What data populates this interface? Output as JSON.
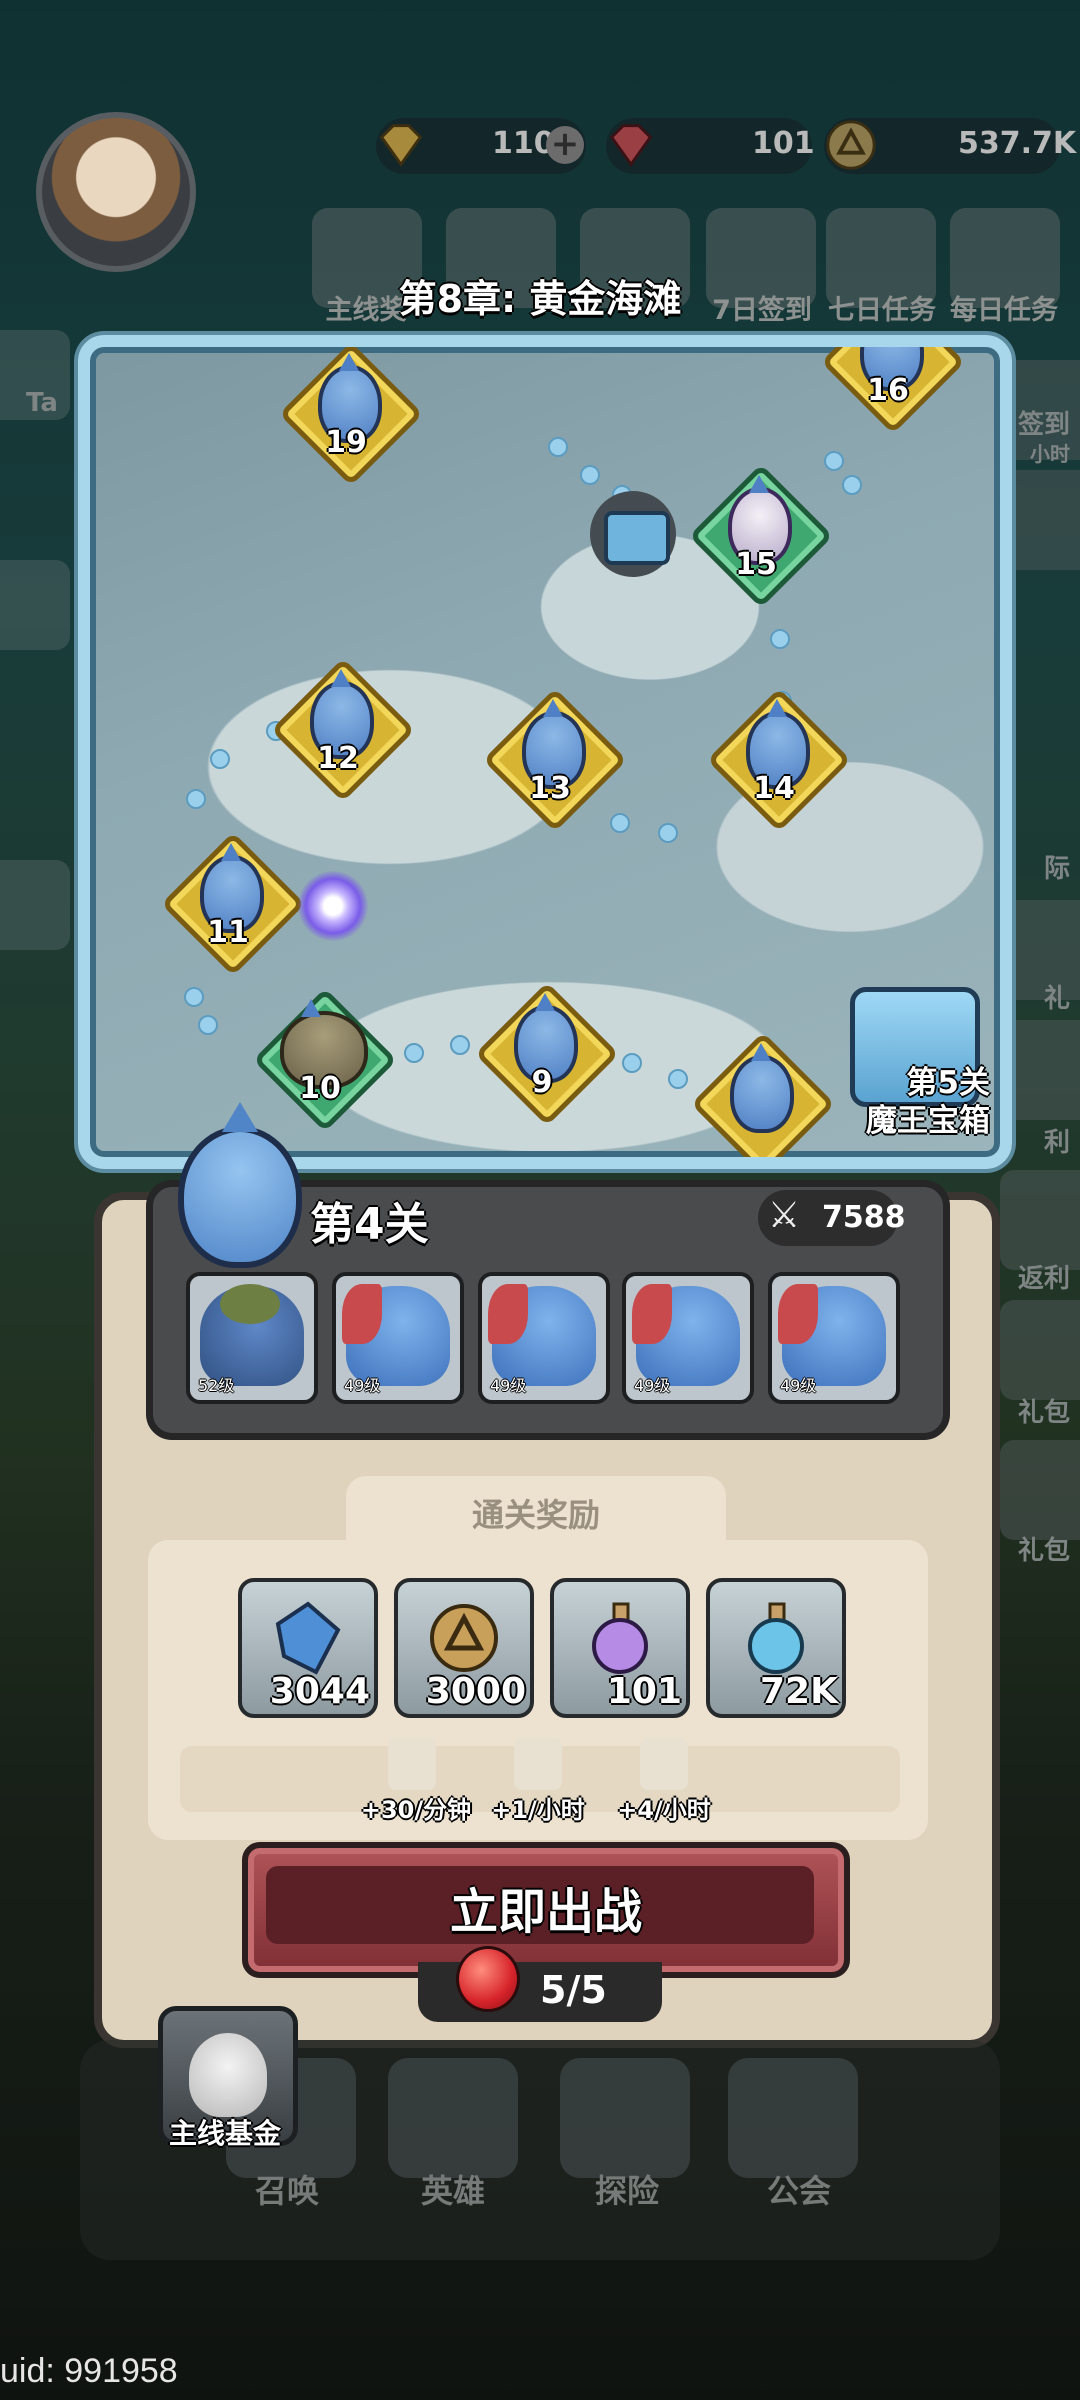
{
  "resources": {
    "gold_gem": "110",
    "red_gem": "101",
    "coins": "537.7K"
  },
  "top_icons": [
    "主线奖",
    "",
    "",
    "7日签到",
    "七日任务",
    "每日任务"
  ],
  "side_left": [
    "Ta"
  ],
  "side_right": [
    "签到",
    "小时",
    "际",
    "礼",
    "利",
    "返利",
    "礼包",
    "礼包"
  ],
  "chapter_title": "第8章: 黄金海滩",
  "map": {
    "nodes": [
      "19",
      "16",
      "15",
      "12",
      "13",
      "14",
      "11",
      "10",
      "9"
    ],
    "boss_chest": {
      "line1": "第5关",
      "line2": "魔王宝箱"
    }
  },
  "stage": {
    "title": "第4关",
    "power": "7588",
    "heroes": [
      {
        "level": "52级",
        "kind": "frog"
      },
      {
        "level": "49级",
        "kind": "shark"
      },
      {
        "level": "49级",
        "kind": "shark"
      },
      {
        "level": "49级",
        "kind": "shark"
      },
      {
        "level": "49级",
        "kind": "shark"
      }
    ]
  },
  "rewards": {
    "title": "通关奖励",
    "items": [
      {
        "name": "crystal-icon",
        "value": "3044",
        "color": "#4f8fd6"
      },
      {
        "name": "coin-icon",
        "value": "3000",
        "color": "#c8a05a"
      },
      {
        "name": "purple-potion-icon",
        "value": "101",
        "color": "#b58be6"
      },
      {
        "name": "blue-potion-icon",
        "value": "72K",
        "color": "#6cc4e8"
      }
    ],
    "rates": [
      "+30/分钟",
      "+1/小时",
      "+4/小时"
    ]
  },
  "fight_button": "立即出战",
  "stamina": "5/5",
  "bottom_nav": {
    "fund": "主线基金",
    "items": [
      "召唤",
      "英雄",
      "探险",
      "公会"
    ]
  },
  "uid": "uid: 991958"
}
